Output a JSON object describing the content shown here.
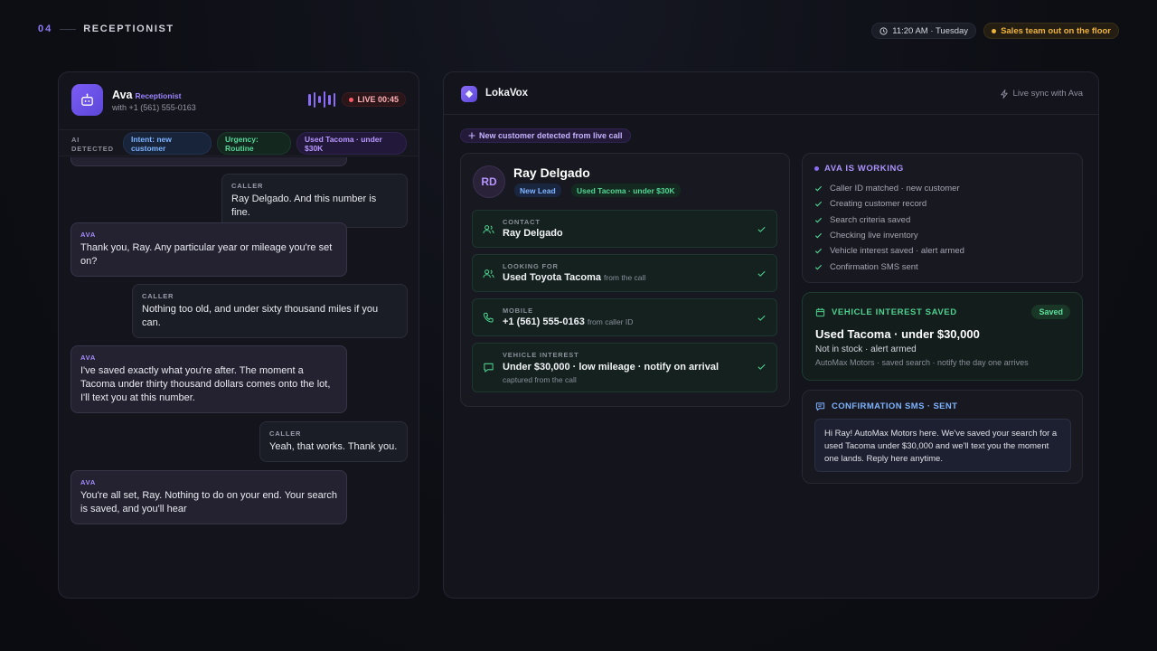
{
  "header": {
    "step_number": "04",
    "step_title": "RECEPTIONIST",
    "time": "11:20 AM · Tuesday",
    "status": "Sales team out on the floor"
  },
  "call": {
    "agent_name": "Ava",
    "agent_role": "Receptionist",
    "with": "with +1 (561) 555-0163",
    "live_label": "LIVE 00:45",
    "detected_label": "AI DETECTED",
    "chips": {
      "intent": "Intent: new customer",
      "urgency": "Urgency: Routine",
      "want": "Used Tacoma · under $30K"
    },
    "messages": [
      {
        "who": "CALLER",
        "text": "Ray Delgado. And this number is fine."
      },
      {
        "who": "AVA",
        "text": "Thank you, Ray. Any particular year or mileage you're set on?"
      },
      {
        "who": "CALLER",
        "text": "Nothing too old, and under sixty thousand miles if you can."
      },
      {
        "who": "AVA",
        "text": "I've saved exactly what you're after. The moment a Tacoma under thirty thousand dollars comes onto the lot, I'll text you at this number."
      },
      {
        "who": "CALLER",
        "text": "Yeah, that works. Thank you."
      },
      {
        "who": "AVA",
        "text": "You're all set, Ray. Nothing to do on your end. Your search is saved, and you'll hear"
      }
    ]
  },
  "crm": {
    "app_name": "LokaVox",
    "sync": "Live sync with Ava",
    "new_customer": "New customer detected from live call",
    "record": {
      "initials": "RD",
      "name": "Ray Delgado",
      "badge_new": "New Lead",
      "badge_interest": "Used Tacoma · under $30K",
      "fields": [
        {
          "label": "CONTACT",
          "value": "Ray Delgado",
          "note": "",
          "sub": ""
        },
        {
          "label": "LOOKING FOR",
          "value": "Used Toyota Tacoma",
          "note": "from the call",
          "sub": ""
        },
        {
          "label": "MOBILE",
          "value": "+1 (561) 555-0163",
          "note": "from caller ID",
          "sub": ""
        },
        {
          "label": "VEHICLE INTEREST",
          "value": "Under $30,000 · low mileage · notify on arrival",
          "note": "",
          "sub": "captured from the call"
        }
      ]
    },
    "working": {
      "title": "AVA IS WORKING",
      "steps": [
        "Caller ID matched · new customer",
        "Creating customer record",
        "Search criteria saved",
        "Checking live inventory",
        "Vehicle interest saved · alert armed",
        "Confirmation SMS sent"
      ]
    },
    "vehicle": {
      "title": "VEHICLE INTEREST SAVED",
      "badge": "Saved",
      "main": "Used Tacoma · under $30,000",
      "sub": "Not in stock · alert armed",
      "small": "AutoMax Motors · saved search · notify the day one arrives"
    },
    "sms": {
      "title": "CONFIRMATION SMS · SENT",
      "body": "Hi Ray! AutoMax Motors here. We've saved your search for a used Tacoma under $30,000 and we'll text you the moment one lands. Reply here anytime."
    }
  },
  "colors": {
    "accent": "#8b6cf7",
    "green": "#4fd08f",
    "blue": "#7eb3ff",
    "amber": "#f0b43a",
    "live_red": "#ff5b66"
  }
}
